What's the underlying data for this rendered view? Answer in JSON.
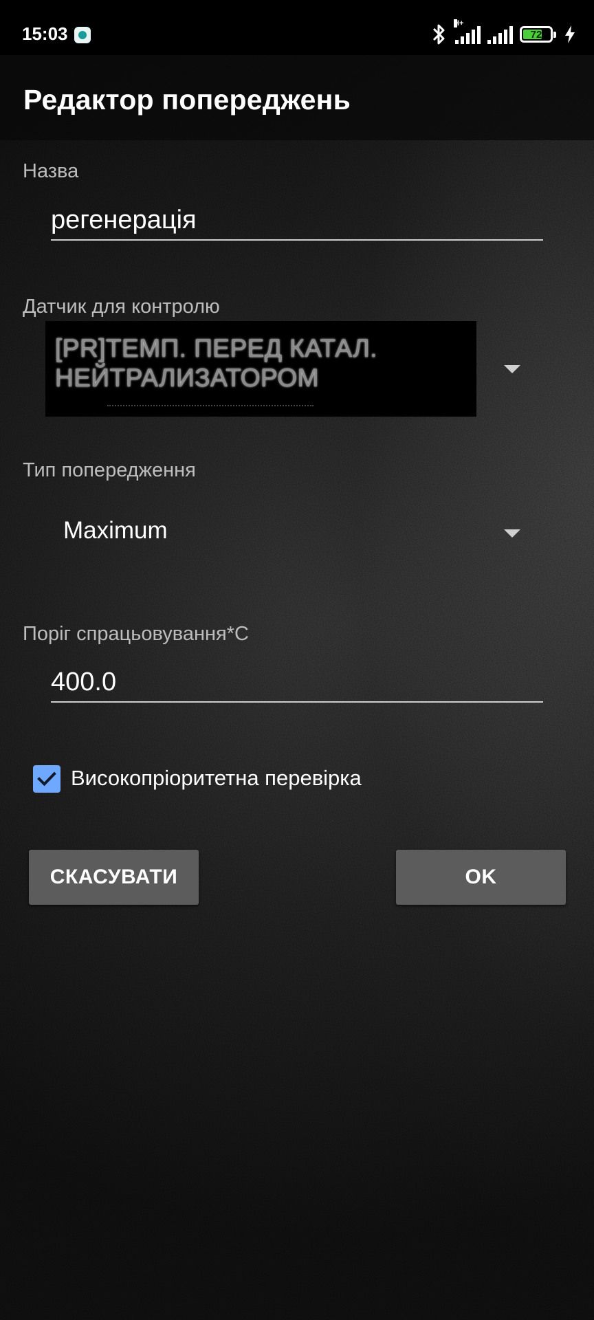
{
  "status_bar": {
    "time": "15:03",
    "network_label": "H+",
    "battery_percent": 72,
    "battery_text": "72"
  },
  "app_bar": {
    "title": "Редактор попереджень"
  },
  "form": {
    "name": {
      "label": "Назва",
      "value": "регенерація"
    },
    "sensor": {
      "label": "Датчик для контролю",
      "value": "[PR]ТЕМП. ПЕРЕД КАТАЛ. НЕЙТРАЛИЗАТОРОМ"
    },
    "warning_type": {
      "label": "Тип попередження",
      "value": "Maximum"
    },
    "threshold": {
      "label": "Поріг спрацьовування*C",
      "value": "400.0"
    },
    "high_priority": {
      "label": "Високопріоритетна перевірка",
      "checked": true
    }
  },
  "buttons": {
    "cancel_label": "СКАСУВАТИ",
    "ok_label": "OK"
  },
  "colors": {
    "checkbox": "#6fa8ff",
    "button_bg": "#5c5c5c",
    "battery_fill": "#4ccd3a"
  }
}
